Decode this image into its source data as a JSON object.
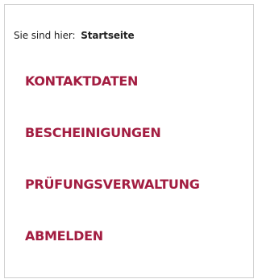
{
  "breadcrumb": {
    "prefix": "Sie sind hier:",
    "current": "Startseite"
  },
  "menu": {
    "items": [
      {
        "label": "KONTAKTDATEN"
      },
      {
        "label": "BESCHEINIGUNGEN"
      },
      {
        "label": "PRÜFUNGSVERWALTUNG"
      },
      {
        "label": "ABMELDEN"
      }
    ]
  },
  "colors": {
    "link": "#a31d41",
    "text": "#222222",
    "border": "#cfcfcf"
  }
}
